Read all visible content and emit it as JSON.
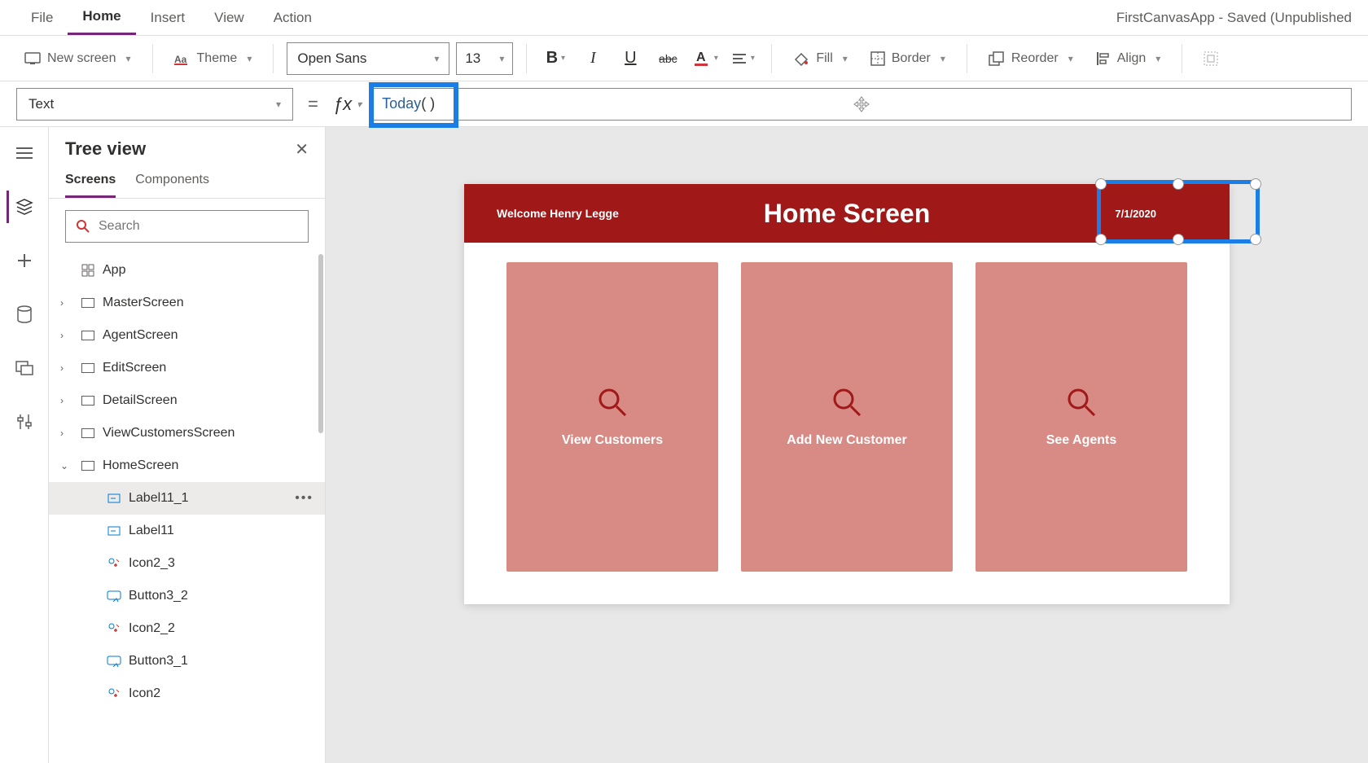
{
  "app_title": "FirstCanvasApp - Saved (Unpublished",
  "menu": {
    "file": "File",
    "home": "Home",
    "insert": "Insert",
    "view": "View",
    "action": "Action"
  },
  "ribbon": {
    "new_screen": "New screen",
    "theme": "Theme",
    "font": "Open Sans",
    "size": "13",
    "fill": "Fill",
    "border": "Border",
    "reorder": "Reorder",
    "align": "Align"
  },
  "formula": {
    "property": "Text",
    "fn": "Today",
    "parens": "( )"
  },
  "tree": {
    "title": "Tree view",
    "tabs": {
      "screens": "Screens",
      "components": "Components"
    },
    "search_ph": "Search",
    "root": "App",
    "screens": [
      "MasterScreen",
      "AgentScreen",
      "EditScreen",
      "DetailScreen",
      "ViewCustomersScreen"
    ],
    "home": "HomeScreen",
    "children": [
      "Label11_1",
      "Label11",
      "Icon2_3",
      "Button3_2",
      "Icon2_2",
      "Button3_1",
      "Icon2"
    ]
  },
  "canvas": {
    "welcome": "Welcome Henry Legge",
    "title": "Home Screen",
    "date": "7/1/2020",
    "cards": [
      "View Customers",
      "Add New Customer",
      "See Agents"
    ]
  }
}
